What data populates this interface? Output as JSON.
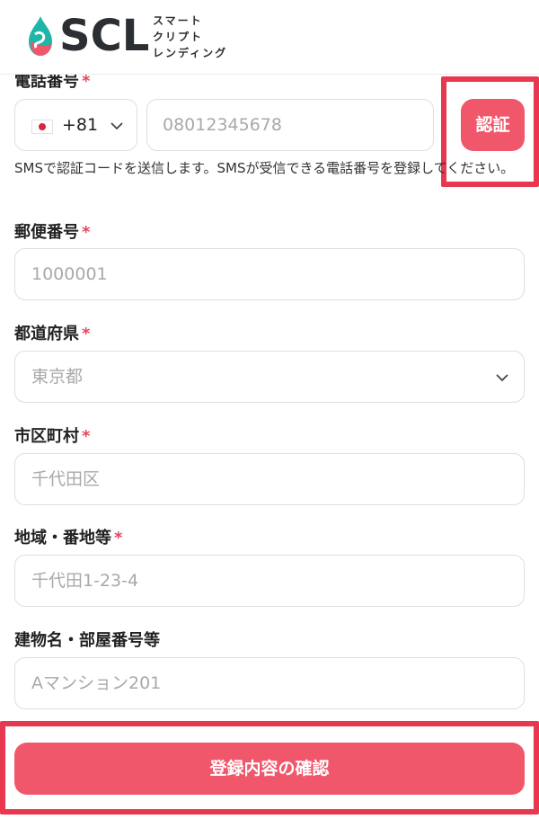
{
  "header": {
    "logo_text": "SCL",
    "logo_sub": [
      "スマート",
      "クリプト",
      "レンディング"
    ]
  },
  "phone": {
    "label": "電話番号",
    "required_mark": "*",
    "country_code": "+81",
    "placeholder": "08012345678",
    "verify_label": "認証",
    "hint": "SMSで認証コードを送信します。SMSが受信できる電話番号を登録してください。"
  },
  "postal": {
    "label": "郵便番号",
    "required_mark": "*",
    "placeholder": "1000001"
  },
  "prefecture": {
    "label": "都道府県",
    "required_mark": "*",
    "value": "東京都"
  },
  "city": {
    "label": "市区町村",
    "required_mark": "*",
    "placeholder": "千代田区"
  },
  "area": {
    "label": "地域・番地等",
    "required_mark": "*",
    "placeholder": "千代田1-23-4"
  },
  "building": {
    "label": "建物名・部屋番号等",
    "placeholder": "Aマンション201"
  },
  "submit": {
    "label": "登録内容の確認"
  },
  "colors": {
    "accent": "#f0576b",
    "highlight": "#e8384f",
    "required": "#e8465c"
  }
}
